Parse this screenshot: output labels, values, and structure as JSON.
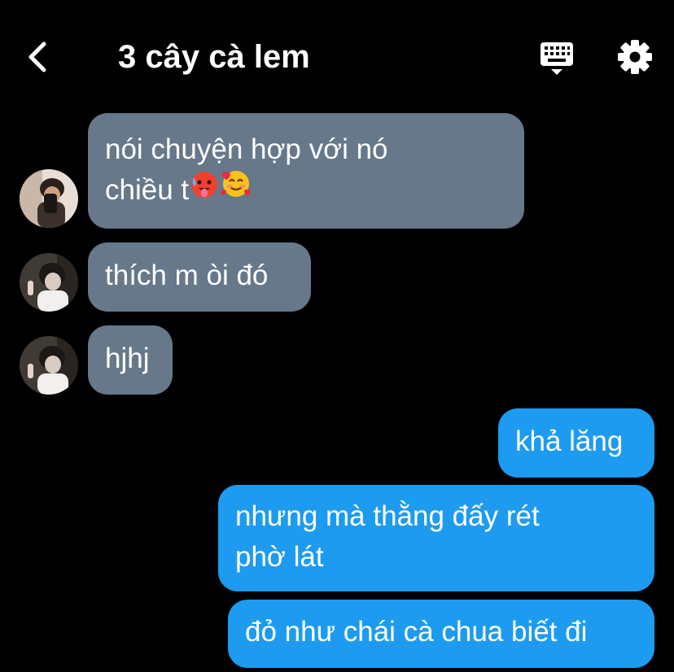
{
  "header": {
    "title": "3 cây cà lem",
    "back_icon": "chevron-left-icon",
    "keyboard_icon": "keyboard-icon",
    "settings_icon": "gear-icon"
  },
  "messages": [
    {
      "direction": "incoming",
      "lines": [
        "nói chuyện hợp với nó",
        "chiều t"
      ],
      "emoji": [
        "hot-face-emoji",
        "smiling-face-with-hearts-emoji"
      ]
    },
    {
      "direction": "incoming",
      "lines": [
        "thích m òi đó"
      ]
    },
    {
      "direction": "incoming",
      "lines": [
        "hjhj"
      ]
    },
    {
      "direction": "outgoing",
      "lines": [
        "khả lăng"
      ]
    },
    {
      "direction": "outgoing",
      "lines": [
        "nhưng mà thằng đấy rét",
        "phờ lát"
      ]
    },
    {
      "direction": "outgoing",
      "lines": [
        "đỏ như chái cà chua biết đi"
      ]
    }
  ],
  "colors": {
    "background": "#000000",
    "incoming_bubble": "#66788a",
    "outgoing_bubble": "#1d9bf0",
    "text": "#ffffff"
  }
}
